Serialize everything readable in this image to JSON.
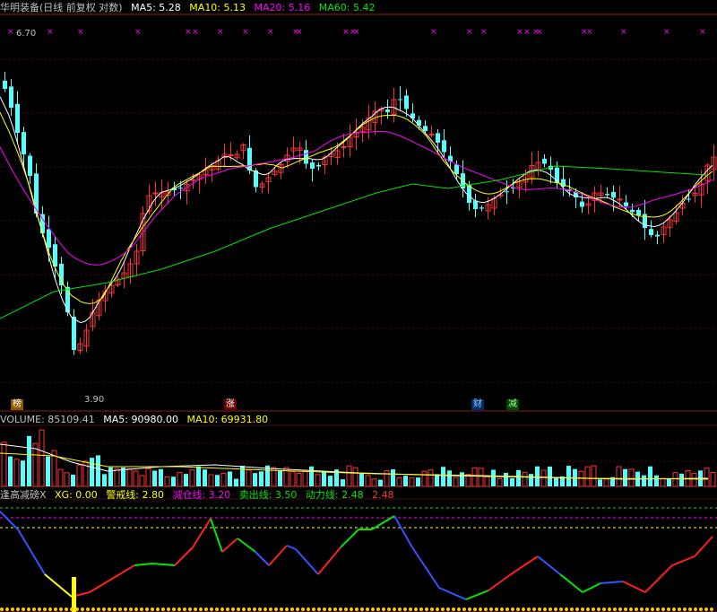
{
  "header": {
    "title": "华明装备(日线 前复权 对数)",
    "ma5": "MA5: 5.28",
    "ma10": "MA10: 5.13",
    "ma20": "MA20: 5.16",
    "ma60": "MA60: 5.42"
  },
  "price_panel": {
    "high_label": "6.70",
    "low_label": "3.90",
    "tags": [
      "榜",
      "涨",
      "财",
      "减"
    ]
  },
  "volume_header": {
    "volume": "VOLUME: 85109.41",
    "ma5": "MA5: 90980.00",
    "ma10": "MA10: 69931.80"
  },
  "indicator_header": {
    "name": "逢高减磅X",
    "xg": "XG: 0.00",
    "jingjie": "警戒线: 2.80",
    "jiancang": "减仓线: 3.20",
    "maichu": "卖出线: 3.50",
    "dongli": "动力线: 2.48",
    "dongli_value": "2.48"
  },
  "colors": {
    "up": "#ff3232",
    "down": "#54ffff",
    "ma5": "#ffffff",
    "ma10": "#ffff00",
    "ma20": "#ff00ff",
    "ma60": "#00e600",
    "grid": "#8b1a1a"
  }
}
